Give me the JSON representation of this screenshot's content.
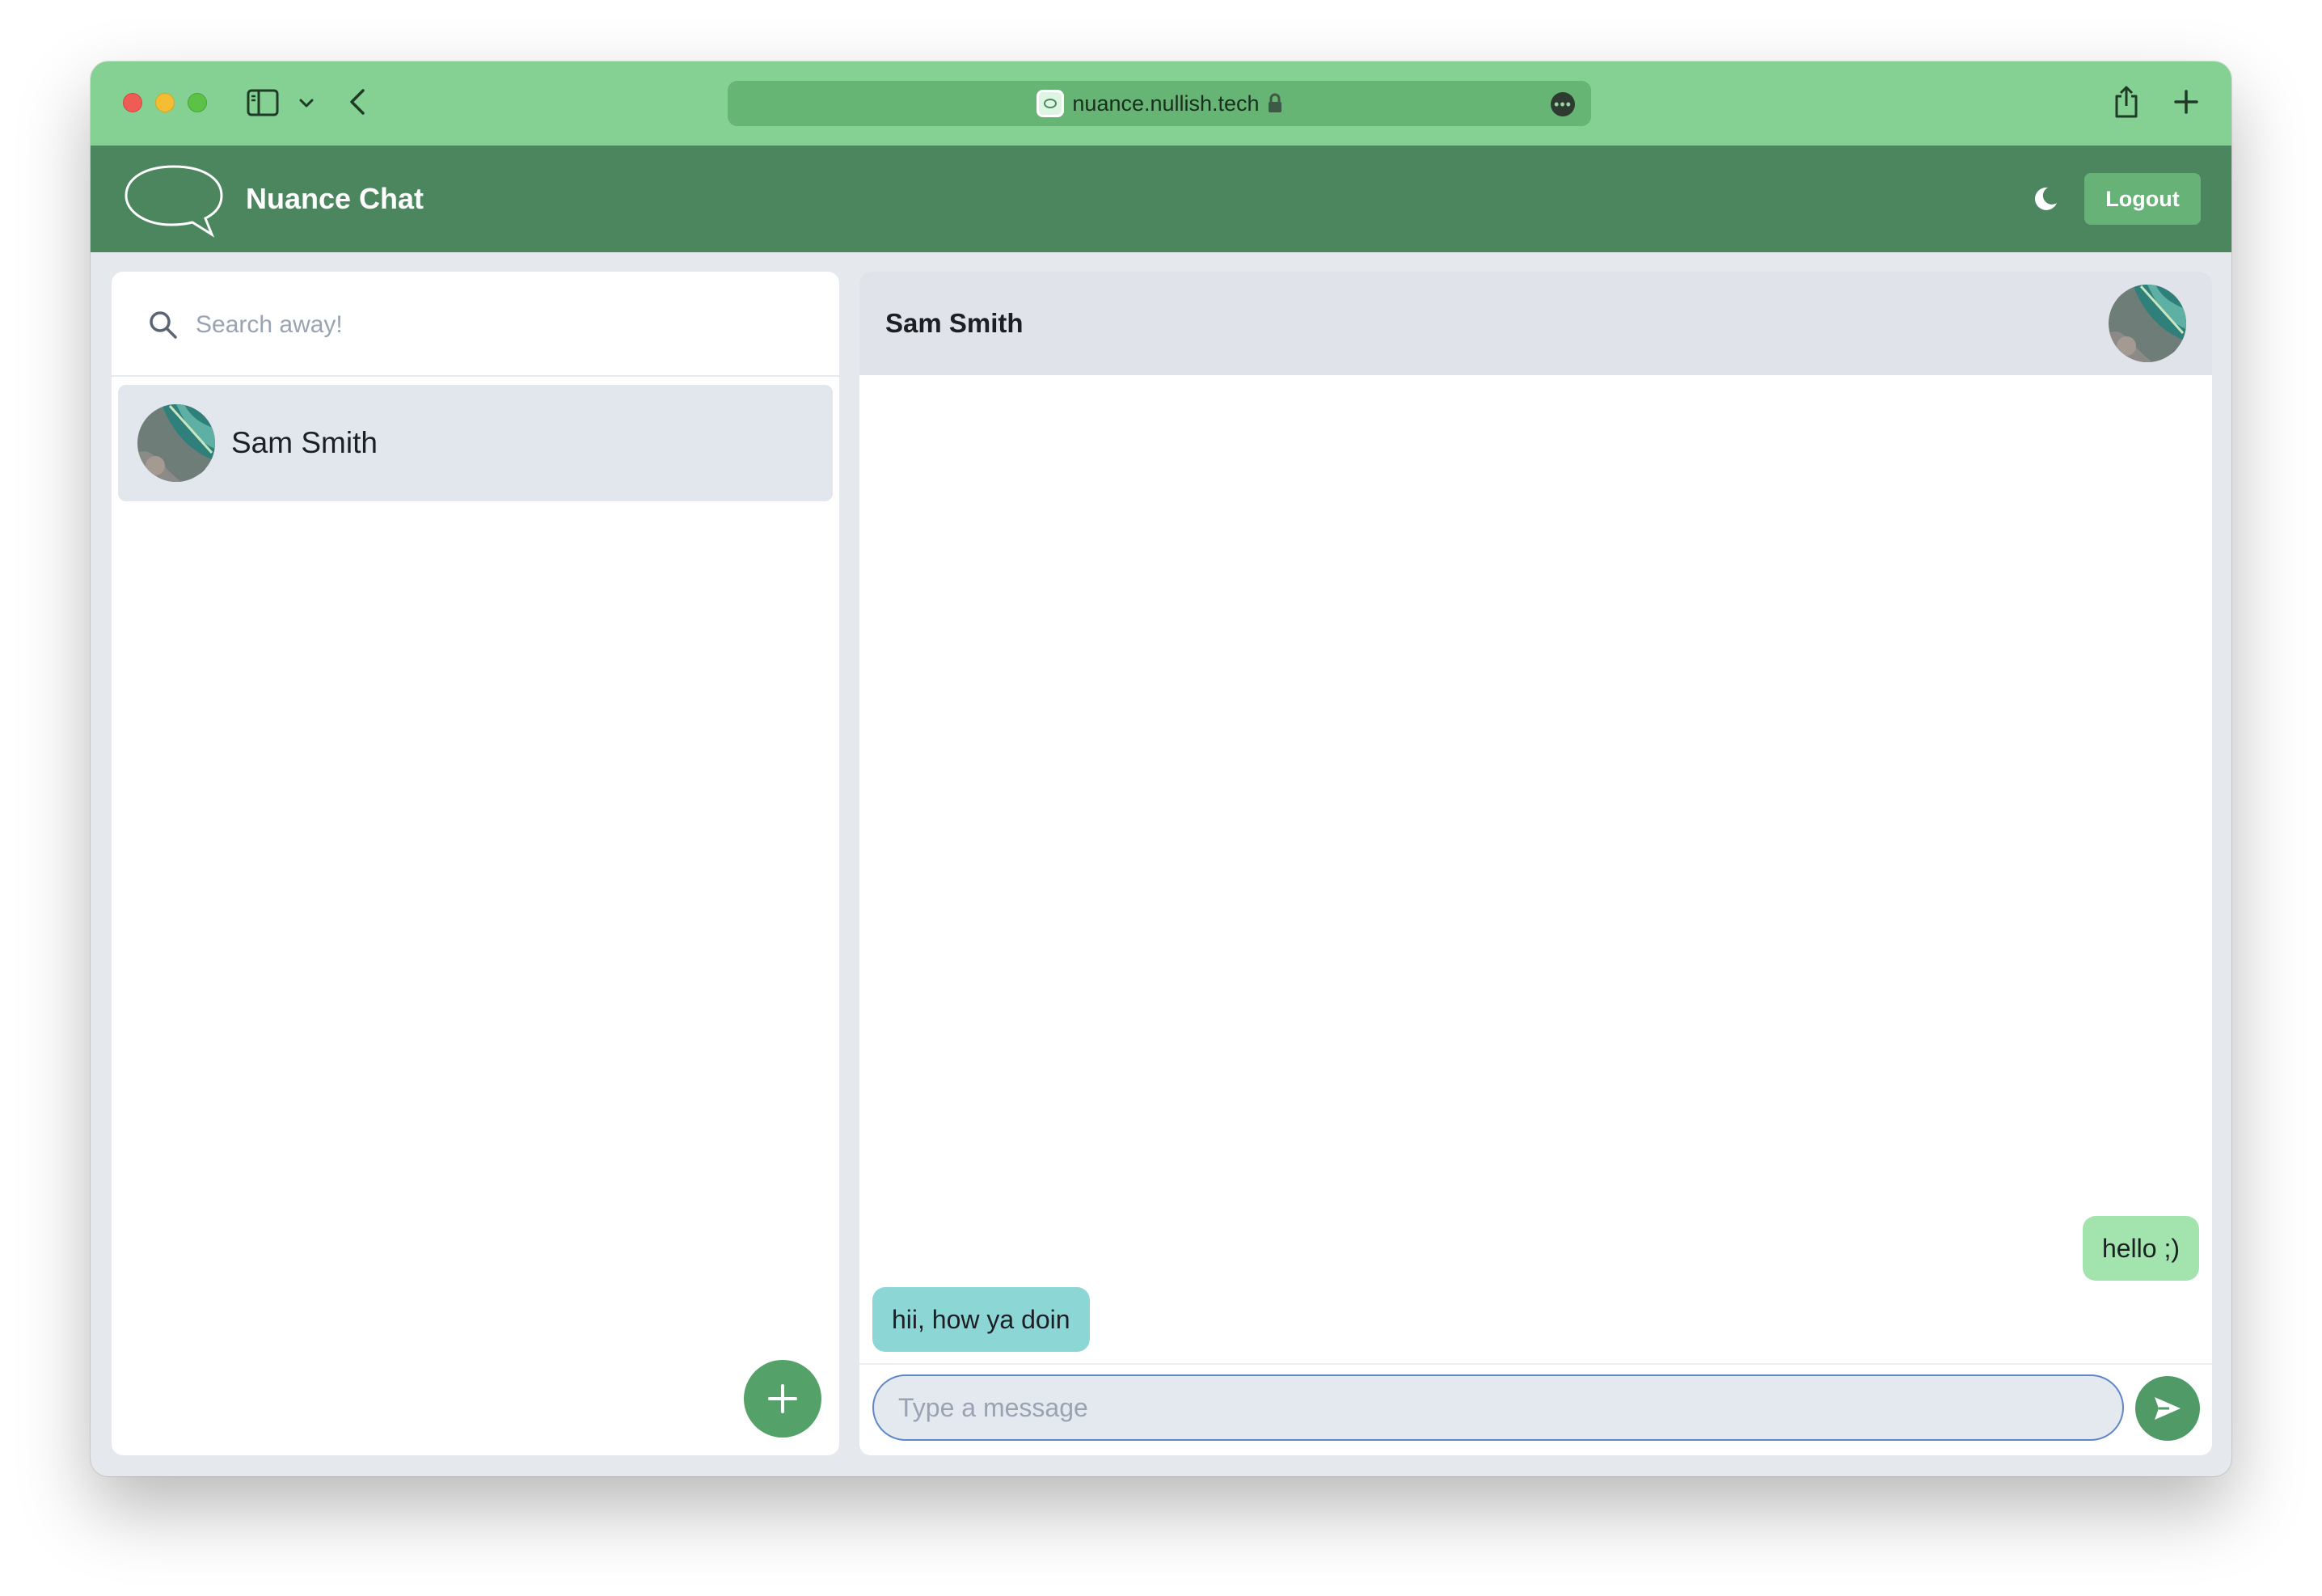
{
  "browser": {
    "url": "nuance.nullish.tech"
  },
  "app": {
    "title": "Nuance Chat",
    "logout_label": "Logout"
  },
  "sidebar": {
    "search_placeholder": "Search away!",
    "contacts": [
      {
        "name": "Sam Smith"
      }
    ]
  },
  "chat": {
    "contact_name": "Sam Smith",
    "messages": [
      {
        "direction": "sent",
        "text": "hello ;)"
      },
      {
        "direction": "received",
        "text": "hii, how ya doin"
      }
    ],
    "input_placeholder": "Type a message"
  },
  "colors": {
    "browser_chrome": "#84d193",
    "app_header": "#4b865e",
    "accent_button": "#67b277",
    "sent_bubble": "#a3e4ae",
    "received_bubble": "#8dd6d6"
  },
  "icons": [
    "sidebar-toggle-icon",
    "chevron-down-icon",
    "back-arrow-icon",
    "lock-icon",
    "more-icon",
    "share-icon",
    "plus-icon",
    "chat-bubble-logo",
    "moon-icon",
    "search-icon",
    "send-icon"
  ]
}
